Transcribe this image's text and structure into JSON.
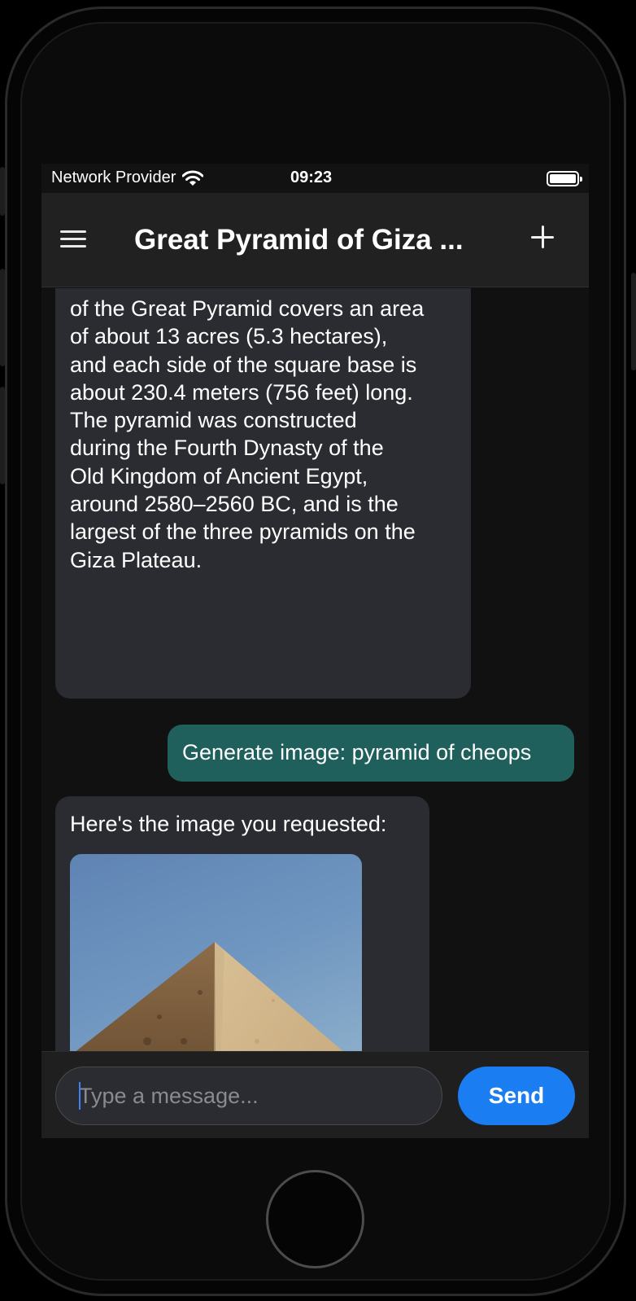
{
  "status_bar": {
    "carrier": "Network Provider",
    "time": "09:23"
  },
  "nav": {
    "title": "Great Pyramid of Giza ...",
    "menu_icon": "hamburger-menu-icon",
    "new_chat_icon": "plus-icon"
  },
  "messages": [
    {
      "role": "assistant",
      "lines": [
        "of the Great Pyramid covers an area",
        "of about 13 acres (5.3 hectares),",
        "and each side of the square base is",
        "about 230.4 meters (756 feet) long.",
        "The pyramid was constructed",
        "during the Fourth Dynasty of the",
        "Old Kingdom of Ancient Egypt,",
        "around 2580–2560 BC, and is the",
        "largest of the three pyramids on the",
        "Giza Plateau."
      ]
    },
    {
      "role": "user",
      "text": "Generate image: pyramid of cheops"
    },
    {
      "role": "assistant",
      "text": "Here's the image you requested:",
      "image_icon": "pyramid-image"
    }
  ],
  "composer": {
    "placeholder": "Type a message...",
    "send_label": "Send"
  },
  "colors": {
    "user_bubble": "#1f5f5c",
    "bot_bubble": "#2b2c31",
    "send_button": "#1a7ef2"
  }
}
